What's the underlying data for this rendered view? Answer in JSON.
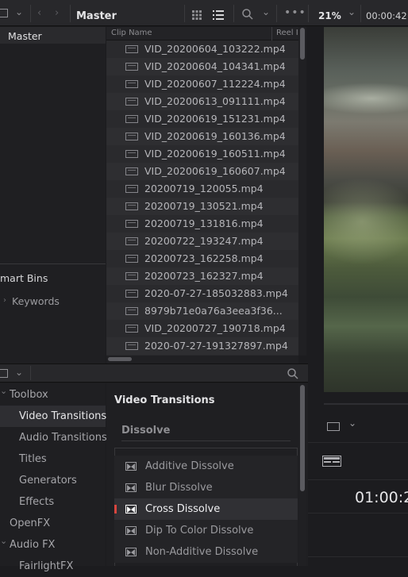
{
  "topbar": {
    "bin_title": "Master",
    "zoom": "21%",
    "timecode": "00:00:42:"
  },
  "bins": {
    "master_label": "Master",
    "smart_bins_label": "mart Bins",
    "keywords_label": "Keywords"
  },
  "clips": {
    "col_clip_name": "Clip Name",
    "col_reel": "Reel I",
    "items": [
      "VID_20200604_103222.mp4",
      "VID_20200604_104341.mp4",
      "VID_20200607_112224.mp4",
      "VID_20200613_091111.mp4",
      "VID_20200619_151231.mp4",
      "VID_20200619_160136.mp4",
      "VID_20200619_160511.mp4",
      "VID_20200619_160607.mp4",
      "20200719_120055.mp4",
      "20200719_130521.mp4",
      "20200719_131816.mp4",
      "20200722_193247.mp4",
      "20200723_162258.mp4",
      "20200723_162327.mp4",
      "2020-07-27-185032883.mp4",
      "8979b71e0a76a3eea3f36...",
      "VID_20200727_190718.mp4",
      "2020-07-27-191327897.mp4"
    ]
  },
  "toolbox": {
    "items": [
      {
        "label": "Toolbox",
        "level": 0,
        "expanded": true
      },
      {
        "label": "Video Transitions",
        "level": 1,
        "selected": true
      },
      {
        "label": "Audio Transitions",
        "level": 1
      },
      {
        "label": "Titles",
        "level": 1
      },
      {
        "label": "Generators",
        "level": 1
      },
      {
        "label": "Effects",
        "level": 1
      },
      {
        "label": "OpenFX",
        "level": 0
      },
      {
        "label": "Audio FX",
        "level": 0,
        "expanded": true
      },
      {
        "label": "FairlightFX",
        "level": 1
      }
    ]
  },
  "effects": {
    "title": "Video Transitions",
    "group": "Dissolve",
    "items": [
      {
        "label": "Additive Dissolve"
      },
      {
        "label": "Blur Dissolve"
      },
      {
        "label": "Cross Dissolve",
        "selected": true
      },
      {
        "label": "Dip To Color Dissolve"
      },
      {
        "label": "Non-Additive Dissolve"
      }
    ]
  },
  "viewer": {
    "timecode": "01:00:2"
  },
  "colors": {
    "accent_red": "#d8453e",
    "panel": "#2a2a2d",
    "background": "#1c1c1f"
  }
}
